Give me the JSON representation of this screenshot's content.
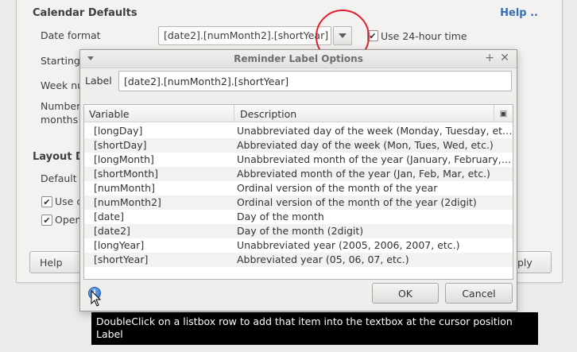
{
  "background": {
    "calendar_defaults_title": "Calendar Defaults",
    "help_link": "Help ..",
    "date_format_label": "Date format",
    "date_format_value": "[date2].[numMonth2].[shortYear]",
    "use_24h_label": "Use 24-hour time",
    "starting_label": "Starting",
    "week_label": "Week nu",
    "number_label": "Number",
    "months_label": "months",
    "layout_title": "Layout De",
    "default_label": "Default T",
    "use_c_label": "Use c",
    "open_label": "Open",
    "help_button": "Help",
    "apply_button": "ply"
  },
  "dialog": {
    "title": "Reminder Label Options",
    "label_caption": "Label",
    "label_value": "[date2].[numMonth2].[shortYear]",
    "columns": [
      "Variable",
      "Description"
    ],
    "rows": [
      {
        "variable": "[longDay]",
        "description": "Unabbreviated day of the week (Monday, Tuesday, etc.)"
      },
      {
        "variable": "[shortDay]",
        "description": "Abbreviated day of the week (Mon, Tues, Wed, etc.)"
      },
      {
        "variable": "[longMonth]",
        "description": "Unabbreviated month of the year (January, February, M..."
      },
      {
        "variable": "[shortMonth]",
        "description": "Abbreviated month of the year (Jan, Feb, Mar, etc.)"
      },
      {
        "variable": "[numMonth]",
        "description": "Ordinal version of the month of the year"
      },
      {
        "variable": "[numMonth2]",
        "description": "Ordinal version of the month of the year (2digit)"
      },
      {
        "variable": "[date]",
        "description": "Day of the month"
      },
      {
        "variable": "[date2]",
        "description": "Day of the month (2digit)"
      },
      {
        "variable": "[longYear]",
        "description": "Unabbreviated year (2005, 2006, 2007, etc.)"
      },
      {
        "variable": "[shortYear]",
        "description": "Abbreviated year (05, 06, 07, etc.)"
      }
    ],
    "ok_button": "OK",
    "cancel_button": "Cancel",
    "info_icon": "i"
  },
  "tooltip": {
    "line1": "DoubleClick on a listbox row to add that item into the textbox at the cursor position",
    "line2": "Label"
  },
  "colors": {
    "highlight_circle": "#e0202a",
    "help_link": "#3a6fb0",
    "tooltip_bg": "#000000"
  },
  "icons": [
    "dropdown-arrow-icon",
    "checkbox-checked-icon",
    "window-menu-icon",
    "pin-icon",
    "close-icon",
    "column-chooser-icon",
    "info-icon",
    "mouse-pointer-icon"
  ]
}
